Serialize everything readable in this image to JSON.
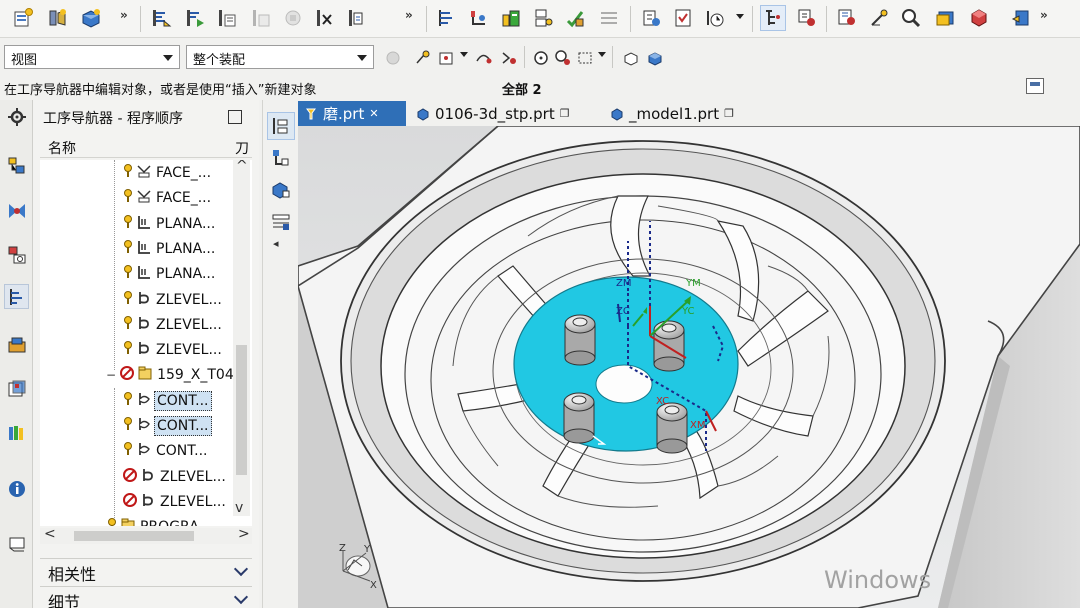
{
  "toolbar": {
    "icons": [
      "create-program-icon",
      "create-tool-icon",
      "create-geometry-icon",
      "more",
      "generate-toolpath-icon",
      "replay-toolpath-icon",
      "list-toolpath-icon",
      "verify-icon",
      "simulate-icon",
      "postprocess-icon",
      "shop-doc-icon",
      "more",
      "program-view-icon",
      "machine-view-icon",
      "geometry-view-icon",
      "method-view-icon",
      "shop-floor-icon",
      "process-icon",
      "feature-icon",
      "time-icon",
      "dropdown",
      "tree-view-icon",
      "filter-icon",
      "analysis-icon",
      "reference-icon",
      "measure-icon",
      "layer-icon",
      "cube-icon",
      "settings-icon"
    ]
  },
  "row2": {
    "view_select": "视图",
    "assembly_select": "整个装配"
  },
  "status": {
    "message": "在工序导航器中编辑对象，或者是使用“插入”新建对象",
    "selection_count": "全部 2"
  },
  "navigator": {
    "title": "工序导航器 - 程序顺序",
    "col_name": "名称",
    "col_tool": "刀",
    "items": [
      {
        "label": "FACE_...",
        "icon": "face-milling-icon",
        "level": 3,
        "status": "ok",
        "selected": false
      },
      {
        "label": "FACE_...",
        "icon": "face-milling-icon",
        "level": 3,
        "status": "ok",
        "selected": false
      },
      {
        "label": "PLANA...",
        "icon": "planar-mill-icon",
        "level": 3,
        "status": "ok",
        "selected": false
      },
      {
        "label": "PLANA...",
        "icon": "planar-mill-icon",
        "level": 3,
        "status": "ok",
        "selected": false
      },
      {
        "label": "PLANA...",
        "icon": "planar-mill-icon",
        "level": 3,
        "status": "ok",
        "selected": false
      },
      {
        "label": "ZLEVEL...",
        "icon": "zlevel-icon",
        "level": 3,
        "status": "ok",
        "selected": false
      },
      {
        "label": "ZLEVEL...",
        "icon": "zlevel-icon",
        "level": 3,
        "status": "ok",
        "selected": false
      },
      {
        "label": "ZLEVEL...",
        "icon": "zlevel-icon",
        "level": 3,
        "status": "ok",
        "selected": false
      },
      {
        "label": "159_X_T04",
        "icon": "program-folder-icon",
        "level": 2,
        "status": "regenerate",
        "selected": false
      },
      {
        "label": "CONT...",
        "icon": "contour-icon",
        "level": 3,
        "status": "ok",
        "selected": true
      },
      {
        "label": "CONT...",
        "icon": "contour-icon",
        "level": 3,
        "status": "ok",
        "selected": true
      },
      {
        "label": "CONT...",
        "icon": "contour-icon",
        "level": 3,
        "status": "ok",
        "selected": false
      },
      {
        "label": "ZLEVEL...",
        "icon": "zlevel-icon",
        "level": 3,
        "status": "regenerate",
        "selected": false
      },
      {
        "label": "ZLEVEL...",
        "icon": "zlevel-icon",
        "level": 3,
        "status": "regenerate",
        "selected": false
      },
      {
        "label": "PROGRA...",
        "icon": "program-folder-icon",
        "level": 2,
        "status": "ok",
        "selected": false
      }
    ],
    "section_dependencies": "相关性",
    "section_details": "细节"
  },
  "tabs": [
    {
      "label": "磨.prt",
      "active": true
    },
    {
      "label": "0106-3d_stp.prt",
      "active": false
    },
    {
      "label": "_model1.prt",
      "active": false
    }
  ],
  "graphics": {
    "csys_labels": [
      "ZM",
      "YM",
      "XM",
      "ZC",
      "YC",
      "XC"
    ],
    "triad_labels": [
      "Z",
      "Y",
      "X"
    ],
    "watermark": "Windows",
    "colors": {
      "part_face": "#f6f6f6",
      "highlight": "#21c8e3",
      "background": "#e4e5e6"
    }
  }
}
